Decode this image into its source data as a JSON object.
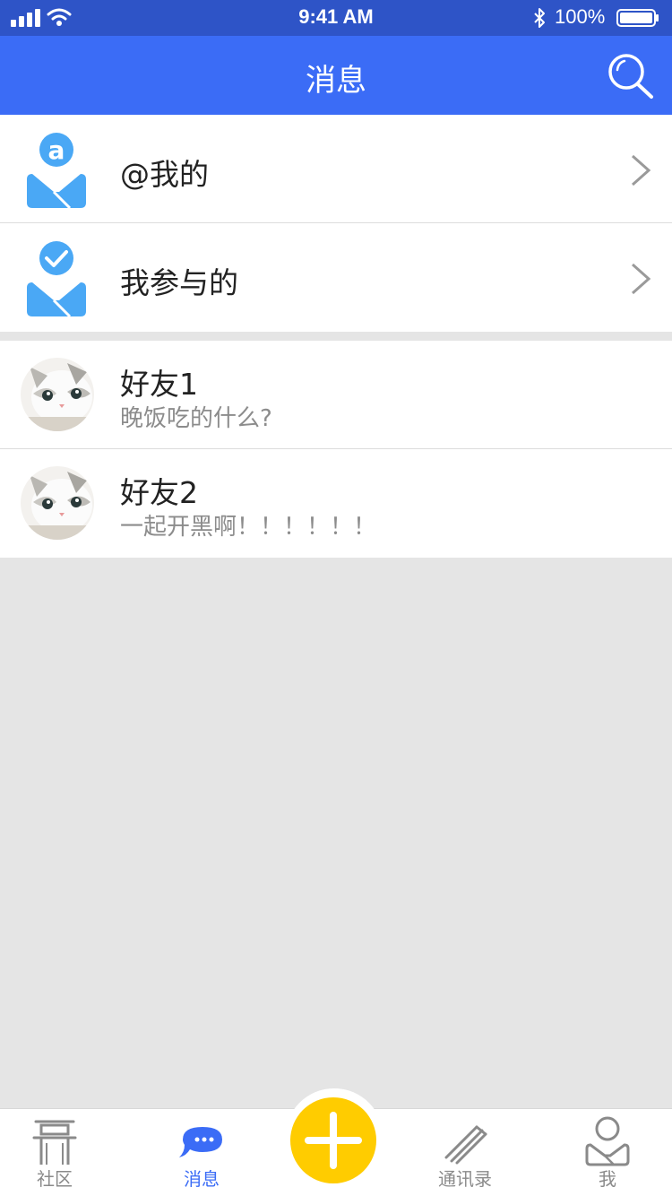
{
  "status_bar": {
    "time": "9:41 AM",
    "battery": "100%"
  },
  "header": {
    "title": "消息"
  },
  "entries": [
    {
      "label": "@我的",
      "icon": "at-mention-user-icon"
    },
    {
      "label": "我参与的",
      "icon": "check-user-icon"
    }
  ],
  "friends": [
    {
      "name": "好友1",
      "message": "晚饭吃的什么?"
    },
    {
      "name": "好友2",
      "message": "一起开黑啊！！！！！！"
    }
  ],
  "tab_bar": {
    "tabs": [
      {
        "label": "社区",
        "icon": "pavilion-icon"
      },
      {
        "label": "消息",
        "icon": "chat-bubble-icon",
        "active": true
      },
      {
        "label": "通讯录",
        "icon": "contacts-book-icon"
      },
      {
        "label": "我",
        "icon": "user-icon"
      }
    ],
    "center_button": {
      "icon": "plus-icon"
    }
  },
  "colors": {
    "primary": "#3b6cf6",
    "status_bar": "#2e54c7",
    "entry_icon": "#4aa8f5",
    "fab": "#ffcc00",
    "background": "#e5e5e5"
  }
}
